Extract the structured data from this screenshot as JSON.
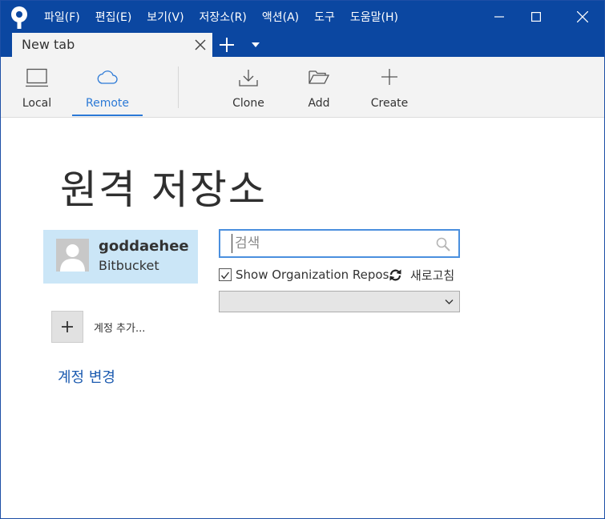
{
  "titlebar": {
    "menu": [
      "파일(F)",
      "편집(E)",
      "보기(V)",
      "저장소(R)",
      "액션(A)",
      "도구",
      "도움말(H)"
    ]
  },
  "tabs": [
    {
      "label": "New tab"
    }
  ],
  "toolbar": {
    "items": [
      {
        "label": "Local",
        "icon": "monitor-icon"
      },
      {
        "label": "Remote",
        "icon": "cloud-icon",
        "active": true
      },
      {
        "label": "Clone",
        "icon": "download-icon"
      },
      {
        "label": "Add",
        "icon": "folder-open-icon"
      },
      {
        "label": "Create",
        "icon": "plus-icon"
      }
    ]
  },
  "main": {
    "title": "원격 저장소",
    "account": {
      "name": "goddaehee",
      "host": "Bitbucket"
    },
    "add_account_label": "계정 추가...",
    "change_account_label": "계정 변경",
    "search": {
      "placeholder": "검색",
      "value": ""
    },
    "show_org_repos_label": "Show Organization Repos",
    "show_org_repos_checked": true,
    "refresh_label": "새로고침",
    "dropdown_value": ""
  },
  "colors": {
    "titlebar": "#0b47a1",
    "accent": "#2b79d6",
    "account_card": "#cbe6f7",
    "link": "#1c5bb0"
  }
}
